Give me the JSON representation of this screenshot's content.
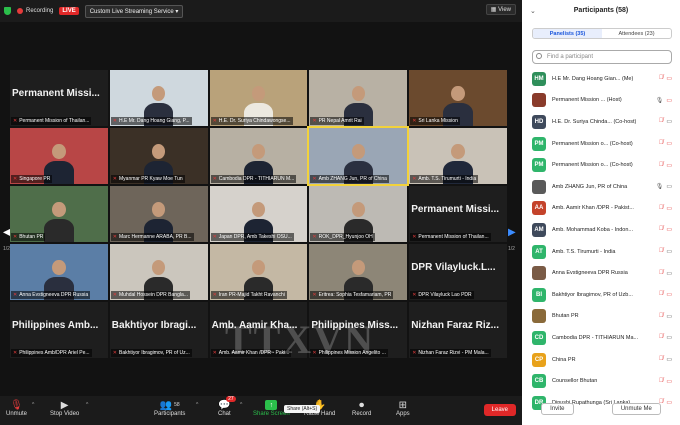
{
  "topbar": {
    "recording": "Recording",
    "live": "LIVE",
    "stream_service": "Custom Live Streaming Service",
    "view": "View"
  },
  "tiles": [
    {
      "big": "Permanent Missi...",
      "caption": "Permanent Mission of Thailan...",
      "video": false
    },
    {
      "big": "",
      "caption": "H.E Mr. Dang Hoang Giang, P...",
      "video": true,
      "bg": "#cfd8de",
      "suit": "#2a2f3e"
    },
    {
      "big": "",
      "caption": "H.E. Dr. Suriya Chindawongse...",
      "video": true,
      "bg": "#b9a27a",
      "suit": "#ece9e0"
    },
    {
      "big": "",
      "caption": "PR Nepal Amrit Rai",
      "video": true,
      "bg": "#b8b1a4",
      "suit": "#2a2f3e"
    },
    {
      "big": "",
      "caption": "Sri Lanka Mission",
      "video": true,
      "bg": "#6b4a2e",
      "suit": "#2a2f3e"
    },
    {
      "big": "",
      "caption": "Singapore PR",
      "video": true,
      "bg": "#b84646",
      "suit": "#1d2433"
    },
    {
      "big": "",
      "caption": "Myanmar PR Kyaw Moe Tun",
      "video": true,
      "bg": "#3b3026",
      "suit": "#1d2433"
    },
    {
      "big": "",
      "caption": "Cambodia DPR - TITHIARUN M...",
      "video": true,
      "bg": "#b7b0a3",
      "suit": "#1d2433"
    },
    {
      "big": "",
      "caption": "Amb ZHANG Jun, PR of China",
      "video": true,
      "bg": "#9aa6b5",
      "suit": "#2b3040",
      "active": true
    },
    {
      "big": "",
      "caption": "Amb. T.S. Tirumurti - India",
      "video": true,
      "bg": "#c9c2b7",
      "suit": "#20283a"
    },
    {
      "big": "",
      "caption": "Bhutan PR",
      "video": true,
      "bg": "#4f6e4a",
      "suit": "#2a2a2a"
    },
    {
      "big": "",
      "caption": "Marc Hermanne ARABA, PR B...",
      "video": true,
      "bg": "#6e655a",
      "suit": "#1d2433"
    },
    {
      "big": "",
      "caption": "Japan DPR, Amb Takeshi OSU...",
      "video": true,
      "bg": "#d6d2cc",
      "suit": "#1d2433"
    },
    {
      "big": "",
      "caption": "ROK_DPR_Hyunjoo OH",
      "video": true,
      "bg": "#bdbab4",
      "suit": "#2a2a2a"
    },
    {
      "big": "Permanent Missi...",
      "caption": "Permanent Mission of Thailan...",
      "video": false
    },
    {
      "big": "",
      "caption": "Anna Evstigneeva DPR Russia",
      "video": true,
      "bg": "#5b7ea6",
      "suit": "#2a2f3e"
    },
    {
      "big": "",
      "caption": "Muhdal Hossein DPR Bangla...",
      "video": true,
      "bg": "#cbc6bd",
      "suit": "#2a2a2a"
    },
    {
      "big": "",
      "caption": "Iran PR-Majid Takht Ravanchi",
      "video": true,
      "bg": "#c4b8a4",
      "suit": "#2a2a2a"
    },
    {
      "big": "",
      "caption": "Eritrea: Sophia Tesfamariam, PR",
      "video": true,
      "bg": "#8d8677",
      "suit": "#2a2a2a"
    },
    {
      "big": "DPR Vilayluck.L...",
      "caption": "DPR Vilayluck Lao PDR",
      "video": false
    },
    {
      "big": "Philippines Amb...",
      "caption": "Philippines Amb/DPR Ariel Pe...",
      "video": false
    },
    {
      "big": "Bakhtiyor Ibragi...",
      "caption": "Bakhtiyor Ibragimov, PR of Uz...",
      "video": false
    },
    {
      "big": "Amb. Aamir Kha...",
      "caption": "Amb. Aamir Khan /DPR - Paki...",
      "video": false
    },
    {
      "big": "Philippines Miss...",
      "caption": "Philippines Mission Angelito ...",
      "video": false
    },
    {
      "big": "Nizhan Faraz Riz...",
      "caption": "Nizhan Faraz Rizvi - PM Mala...",
      "video": false
    }
  ],
  "nav": {
    "left_page": "1/2",
    "right_page": "1/2"
  },
  "toolbar": {
    "unmute": "Unmute",
    "stop_video": "Stop Video",
    "participants": "Participants",
    "participant_count": "58",
    "chat": "Chat",
    "chat_badge": "27",
    "share_screen": "Share Screen",
    "share_tooltip": "Share (Alt+S)",
    "raise_hand": "Raise Hand",
    "record": "Record",
    "apps": "Apps",
    "leave": "Leave"
  },
  "panel": {
    "title": "Participants (58)",
    "tab_panelists": "Panelists (35)",
    "tab_attendees": "Attendees (23)",
    "search_placeholder": "Find a participant",
    "invite": "Invite",
    "unmute_me": "Unmute Me",
    "participants": [
      {
        "initials": "HM",
        "color": "#2f8f5b",
        "name": "H.E Mr. Dang Hoang Gian... (Me)",
        "mic_off": true,
        "cam_off": true
      },
      {
        "initials": "",
        "color": "#8a3b2b",
        "name": "Permanent Mission ... (Host)",
        "mic_off": false,
        "cam_off": true
      },
      {
        "initials": "HD",
        "color": "#3f4a5c",
        "name": "H.E. Dr. Suriya Chinda... (Co-host)",
        "mic_off": true,
        "cam_off": false
      },
      {
        "initials": "PM",
        "color": "#2fb56b",
        "name": "Permanent Mission o... (Co-host)",
        "mic_off": true,
        "cam_off": true
      },
      {
        "initials": "PM",
        "color": "#2fb56b",
        "name": "Permanent Mission o... (Co-host)",
        "mic_off": true,
        "cam_off": true
      },
      {
        "initials": "",
        "color": "#5a5a5a",
        "name": "Amb ZHANG Jun, PR of China",
        "mic_off": false,
        "cam_off": false
      },
      {
        "initials": "AA",
        "color": "#c4432b",
        "name": "Amb. Aamir Khan /DPR - Pakist...",
        "mic_off": true,
        "cam_off": true
      },
      {
        "initials": "AM",
        "color": "#3f4a5c",
        "name": "Amb. Mohammad Koba - Indon...",
        "mic_off": true,
        "cam_off": true
      },
      {
        "initials": "AT",
        "color": "#2fb56b",
        "name": "Amb. T.S. Tirumurti - India",
        "mic_off": true,
        "cam_off": false
      },
      {
        "initials": "",
        "color": "#7a5b46",
        "name": "Anna Evstigneeva DPR Russia",
        "mic_off": true,
        "cam_off": false
      },
      {
        "initials": "BI",
        "color": "#2fb56b",
        "name": "Bakhtiyor Ibragimov, PR of Uzb...",
        "mic_off": true,
        "cam_off": true
      },
      {
        "initials": "",
        "color": "#8a6a3a",
        "name": "Bhutan PR",
        "mic_off": true,
        "cam_off": false
      },
      {
        "initials": "CD",
        "color": "#2fb56b",
        "name": "Cambodia DPR - TITHIARUN Ma...",
        "mic_off": true,
        "cam_off": false
      },
      {
        "initials": "CP",
        "color": "#e8a21b",
        "name": "China PR",
        "mic_off": true,
        "cam_off": false
      },
      {
        "initials": "CB",
        "color": "#2fb56b",
        "name": "Counsellor Bhutan",
        "mic_off": true,
        "cam_off": true
      },
      {
        "initials": "DR",
        "color": "#2fb56b",
        "name": "Dinushi Rupathunga (Sri Lanka)",
        "mic_off": true,
        "cam_off": true
      }
    ]
  }
}
